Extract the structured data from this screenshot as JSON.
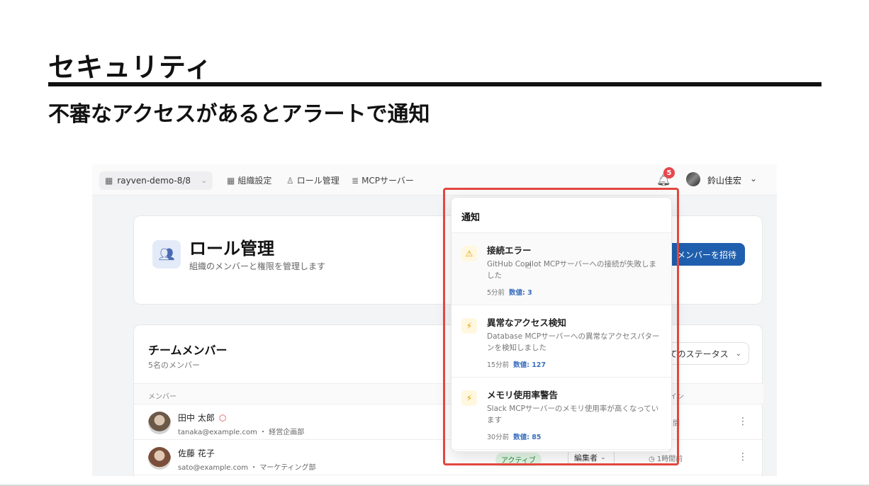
{
  "slide": {
    "title": "セキュリティ",
    "subtitle": "不審なアクセスがあるとアラートで通知"
  },
  "topbar": {
    "org": "rayven-demo-8/8",
    "nav": [
      "組織設定",
      "ロール管理",
      "MCPサーバー"
    ],
    "notification_count": "5",
    "user_name": "鈴山佳宏"
  },
  "role_card": {
    "title": "ロール管理",
    "description": "組織のメンバーと権限を管理します",
    "invite_button": "メンバーを招待"
  },
  "team_card": {
    "title": "チームメンバー",
    "count": "5名のメンバー",
    "status_filter": "てのステータス",
    "columns": {
      "member": "メンバー",
      "last": "イン"
    },
    "rows": [
      {
        "name": "田中 太郎",
        "email": "tanaka@example.com",
        "dept": "経営企画部",
        "time_partial": "間"
      },
      {
        "name": "佐藤 花子",
        "email": "sato@example.com",
        "dept": "マーケティング部",
        "status": "アクティブ",
        "role": "編集者",
        "time": "1時間前"
      }
    ]
  },
  "notifications": {
    "header": "通知",
    "items": [
      {
        "title": "接続エラー",
        "message": "GitHub Copilot MCPサーバーへの接続が失敗しました",
        "time": "5分前",
        "value_label": "数値: 3"
      },
      {
        "title": "異常なアクセス検知",
        "message": "Database MCPサーバーへの異常なアクセスパターンを検知しました",
        "time": "15分前",
        "value_label": "数値: 127"
      },
      {
        "title": "メモリ使用率警告",
        "message": "Slack MCPサーバーのメモリ使用率が高くなっています",
        "time": "30分前",
        "value_label": "数値: 85"
      }
    ]
  },
  "colors": {
    "accent": "#1f5fae",
    "highlight": "#e2473f",
    "badge": "#e5484d",
    "warning": "#e0a000"
  }
}
